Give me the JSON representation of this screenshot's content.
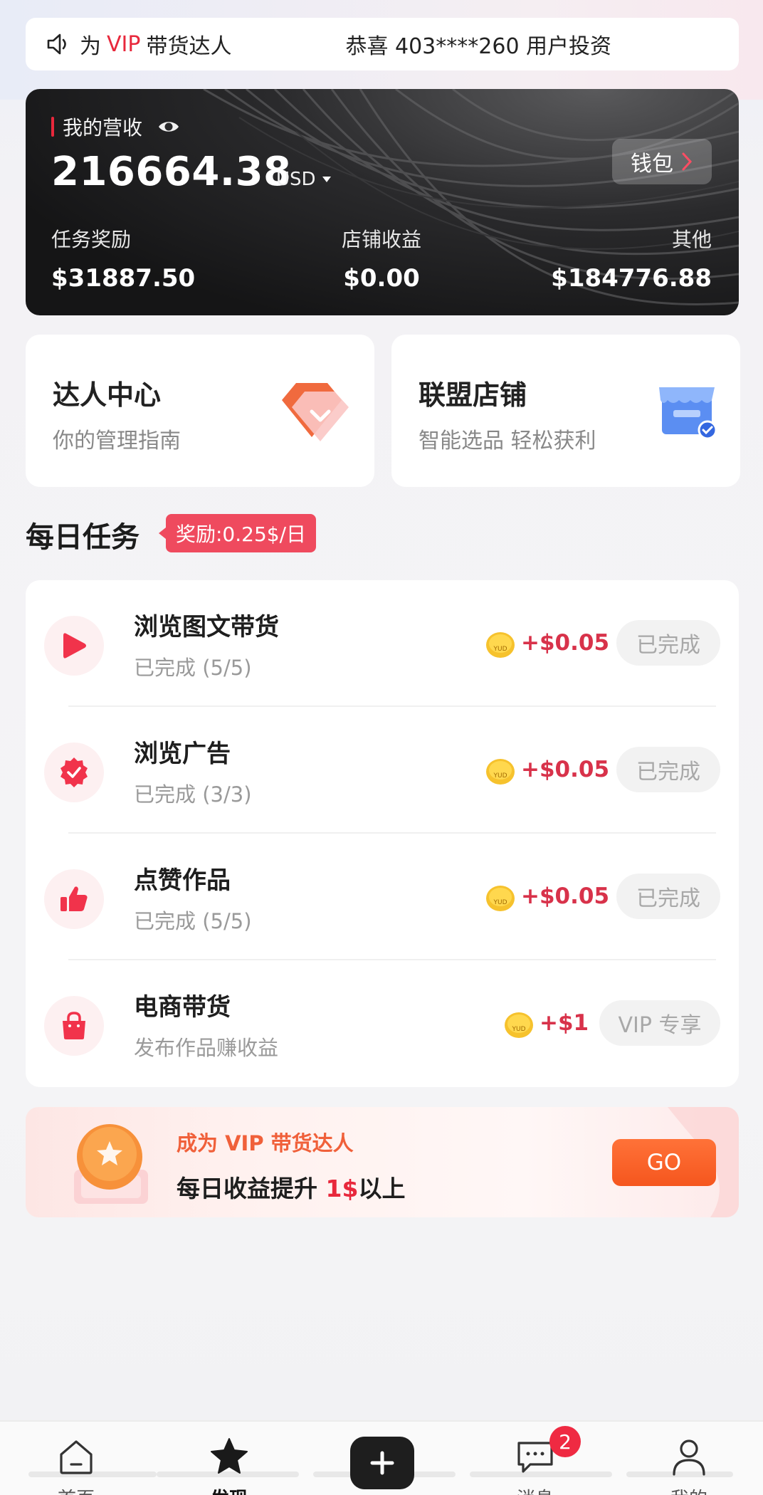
{
  "notice": {
    "prefix": "为",
    "vip": "VIP",
    "suffix": "带货达人",
    "message": "恭喜 403****260 用户投资"
  },
  "revenue": {
    "title": "我的营收",
    "amount": "216664.38",
    "currency": "USD",
    "wallet_label": "钱包",
    "breakdown": [
      {
        "label": "任务奖励",
        "value": "$31887.50"
      },
      {
        "label": "店铺收益",
        "value": "$0.00"
      },
      {
        "label": "其他",
        "value": "$184776.88"
      }
    ]
  },
  "features": {
    "left": {
      "title": "达人中心",
      "subtitle": "你的管理指南"
    },
    "right": {
      "title": "联盟店铺",
      "subtitle": "智能选品 轻松获利"
    }
  },
  "daily": {
    "title": "每日任务",
    "reward_tag": "奖励:0.25$/日"
  },
  "tasks": [
    {
      "name": "浏览图文带货",
      "status": "已完成 (5/5)",
      "reward": "+$0.05",
      "button": "已完成",
      "icon": "play-icon"
    },
    {
      "name": "浏览广告",
      "status": "已完成 (3/3)",
      "reward": "+$0.05",
      "button": "已完成",
      "icon": "verified-badge-icon"
    },
    {
      "name": "点赞作品",
      "status": "已完成 (5/5)",
      "reward": "+$0.05",
      "button": "已完成",
      "icon": "thumbs-up-icon"
    },
    {
      "name": "电商带货",
      "status": "发布作品赚收益",
      "reward": "+$1",
      "button": "VIP 专享",
      "icon": "shopping-bag-icon"
    }
  ],
  "coin_text": "YUD",
  "vip_banner": {
    "line1": "成为 VIP 带货达人",
    "line2_prefix": "每日收益提升 ",
    "line2_highlight": "1$",
    "line2_suffix": "以上",
    "button": "GO"
  },
  "tabbar": {
    "items": [
      {
        "label": "首页",
        "icon": "home-icon"
      },
      {
        "label": "发现",
        "icon": "star-icon"
      },
      {
        "label": "",
        "icon": "plus-icon"
      },
      {
        "label": "消息",
        "icon": "message-icon"
      },
      {
        "label": "我的",
        "icon": "user-icon"
      }
    ],
    "message_badge": "2"
  },
  "colors": {
    "accent_red": "#e8283c",
    "reward_red": "#d8324a",
    "go_orange": "#f5561e",
    "dark_card": "#1a1a1b"
  }
}
